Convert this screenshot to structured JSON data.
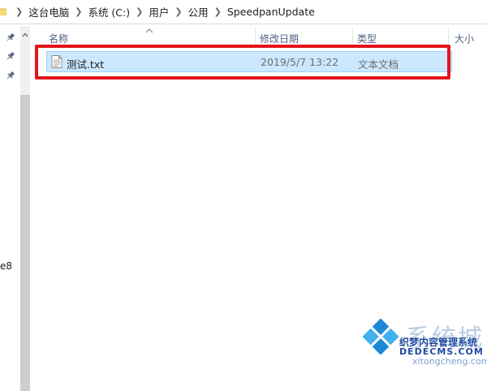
{
  "breadcrumb": [
    "这台电脑",
    "系统 (C:)",
    "用户",
    "公用",
    "SpeedpanUpdate"
  ],
  "columns": {
    "name": "名称",
    "modified": "修改日期",
    "type": "类型",
    "size": "大小"
  },
  "files": [
    {
      "name": "测试.txt",
      "modified": "2019/5/7 13:22",
      "type": "文本文档"
    }
  ],
  "nav": {
    "partial_label": "e8"
  },
  "watermark": {
    "brand": "系统城",
    "line1": "织梦内容管理系统",
    "line2": "DEDECMS.COM",
    "line3": "xitongcheng.com"
  },
  "colors": {
    "selection_bg": "#cce8ff",
    "selection_border": "#99d1ff",
    "highlight_red": "#e3141b",
    "header_text": "#4d6082"
  },
  "icons": {
    "folder": "folder-icon",
    "pin": "pin-icon",
    "file": "text-file-icon",
    "sort": "sort-up-icon"
  }
}
